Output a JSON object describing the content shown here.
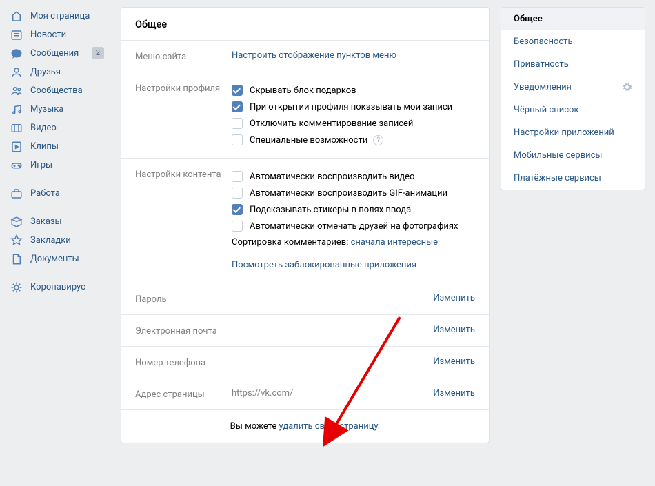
{
  "leftnav": {
    "groups": [
      [
        {
          "icon": "home",
          "label": "Моя страница"
        },
        {
          "icon": "news",
          "label": "Новости"
        },
        {
          "icon": "messages",
          "label": "Сообщения",
          "badge": "2"
        },
        {
          "icon": "friends",
          "label": "Друзья"
        },
        {
          "icon": "communities",
          "label": "Сообщества"
        },
        {
          "icon": "music",
          "label": "Музыка"
        },
        {
          "icon": "video",
          "label": "Видео"
        },
        {
          "icon": "clips",
          "label": "Клипы"
        },
        {
          "icon": "games",
          "label": "Игры"
        }
      ],
      [
        {
          "icon": "work",
          "label": "Работа"
        }
      ],
      [
        {
          "icon": "orders",
          "label": "Заказы"
        },
        {
          "icon": "bookmarks",
          "label": "Закладки"
        },
        {
          "icon": "documents",
          "label": "Документы"
        }
      ],
      [
        {
          "icon": "covid",
          "label": "Коронавирус"
        }
      ]
    ]
  },
  "main": {
    "title": "Общее",
    "site_menu": {
      "label": "Меню сайта",
      "link": "Настроить отображение пунктов меню"
    },
    "profile": {
      "label": "Настройки профиля",
      "items": [
        {
          "checked": true,
          "text": "Скрывать блок подарков"
        },
        {
          "checked": true,
          "text": "При открытии профиля показывать мои записи"
        },
        {
          "checked": false,
          "text": "Отключить комментирование записей"
        },
        {
          "checked": false,
          "text": "Специальные возможности",
          "hint": true
        }
      ]
    },
    "content": {
      "label": "Настройки контента",
      "items": [
        {
          "checked": false,
          "text": "Автоматически воспроизводить видео"
        },
        {
          "checked": false,
          "text": "Автоматически воспроизводить GIF-анимации"
        },
        {
          "checked": true,
          "text": "Подсказывать стикеры в полях ввода"
        },
        {
          "checked": false,
          "text": "Автоматически отмечать друзей на фотографиях"
        }
      ],
      "sort_prefix": "Сортировка комментариев: ",
      "sort_link": "сначала интересные",
      "blocked_link": "Посмотреть заблокированные приложения"
    },
    "password": {
      "label": "Пароль",
      "action": "Изменить"
    },
    "email": {
      "label": "Электронная почта",
      "action": "Изменить"
    },
    "phone": {
      "label": "Номер телефона",
      "action": "Изменить"
    },
    "address": {
      "label": "Адрес страницы",
      "value": "https://vk.com/",
      "action": "Изменить"
    },
    "footer": {
      "prefix": "Вы можете ",
      "link": "удалить свою страницу."
    }
  },
  "right": {
    "items": [
      {
        "label": "Общее",
        "active": true
      },
      {
        "label": "Безопасность"
      },
      {
        "label": "Приватность"
      },
      {
        "label": "Уведомления",
        "gear": true
      },
      {
        "label": "Чёрный список"
      },
      {
        "label": "Настройки приложений"
      },
      {
        "label": "Мобильные сервисы"
      },
      {
        "label": "Платёжные сервисы"
      }
    ]
  }
}
